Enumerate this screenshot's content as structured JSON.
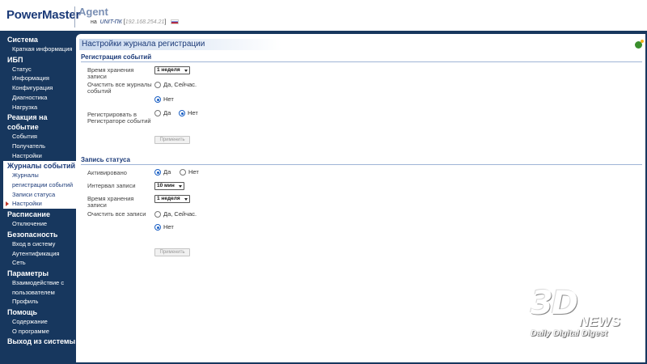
{
  "header": {
    "logo": "PowerMaster",
    "agent": "Agent",
    "on_label": "на",
    "host": "UNIT-ПК",
    "ip": "192.168.254.21"
  },
  "sidebar": {
    "system": {
      "title": "Система",
      "items": [
        "Краткая информация"
      ]
    },
    "ups": {
      "title": "ИБП",
      "items": [
        "Статус",
        "Информация",
        "Конфигурация",
        "Диагностика",
        "Нагрузка"
      ]
    },
    "events": {
      "title_line1": "Реакция на",
      "title_line2": "событие",
      "items": [
        "События",
        "Получатель",
        "Настройки"
      ]
    },
    "logs": {
      "title": "Журналы событий",
      "items": [
        "Журналы",
        "регистрации событий",
        "Записи статуса",
        "Настройки"
      ]
    },
    "schedule": {
      "title": "Расписание",
      "items": [
        "Отключение"
      ]
    },
    "security": {
      "title": "Безопасность",
      "items": [
        "Вход в систему",
        "Аутентификация",
        "Сеть"
      ]
    },
    "params": {
      "title": "Параметры",
      "items": [
        "Взаимодействие с",
        "пользователем",
        "Профиль"
      ]
    },
    "help": {
      "title": "Помощь",
      "items": [
        "Содержание",
        "О программе"
      ]
    },
    "logout": {
      "title": "Выход из системы"
    }
  },
  "main": {
    "page_title": "Настройки журнала регистрации",
    "event_log": {
      "section_title": "Регистрация событий",
      "retention_label_1": "Время хранения",
      "retention_label_2": "записи",
      "retention_value": "1 неделя",
      "clear_label_1": "Очистить все журналы",
      "clear_label_2": "событий",
      "clear_yes": "Да, Сейчас.",
      "clear_no": "Нет",
      "register_label_1": "Регистрировать в",
      "register_label_2": "Регистраторе событий",
      "register_yes": "Да",
      "register_no": "Нет",
      "apply": "Применить"
    },
    "status_log": {
      "section_title": "Запись статуса",
      "enabled_label": "Активировано",
      "enabled_yes": "Да",
      "enabled_no": "Нет",
      "interval_label": "Интервал записи",
      "interval_value": "10 мин",
      "retention_label_1": "Время хранения",
      "retention_label_2": "записи",
      "retention_value": "1 неделя",
      "clear_label": "Очистить все записи",
      "clear_yes": "Да, Сейчас.",
      "clear_no": "Нет",
      "apply": "Применить"
    }
  },
  "watermark": {
    "brand": "3D",
    "news": "NEWS",
    "tagline": "Daily Digital Digest"
  },
  "colors": {
    "sidebar_bg": "#17375e",
    "accent": "#1b3a78",
    "radio_selected": "#1a5fc4"
  }
}
